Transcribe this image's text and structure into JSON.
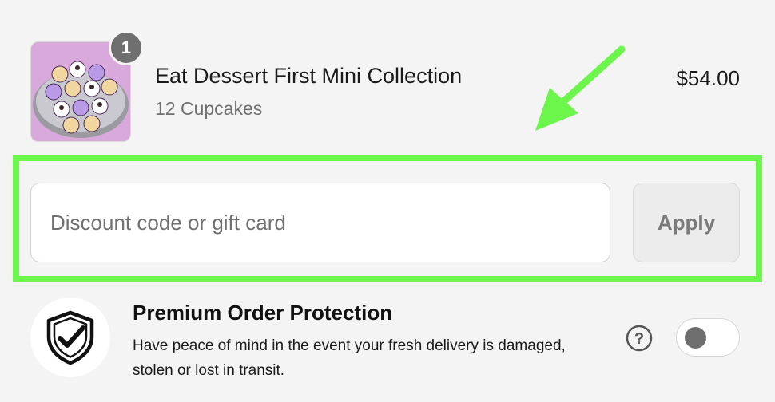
{
  "line_item": {
    "quantity": "1",
    "title": "Eat Dessert First Mini Collection",
    "variant": "12 Cupcakes",
    "price": "$54.00"
  },
  "discount": {
    "placeholder": "Discount code or gift card",
    "value": "",
    "apply_label": "Apply"
  },
  "protection": {
    "title": "Premium Order Protection",
    "description": "Have peace of mind in the event your fresh delivery is damaged, stolen or lost in transit.",
    "enabled": false
  },
  "annotation": {
    "highlight_color": "#6cf64b"
  }
}
